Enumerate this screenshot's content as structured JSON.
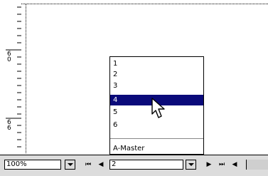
{
  "ruler": {
    "label_top": "6\n0",
    "label_bottom": "6\n6"
  },
  "page_popup": {
    "items": [
      "1",
      "2",
      "3",
      "4",
      "5",
      "6"
    ],
    "selected": "4",
    "master_label": "A-Master"
  },
  "statusbar": {
    "zoom_value": "100%",
    "page_value": "2",
    "nav_first": "⏮",
    "nav_prev": "◀",
    "nav_next": "▶",
    "nav_last": "⏭"
  },
  "colors": {
    "selection": "#0a0a7a",
    "bar": "#dcdcdc"
  }
}
